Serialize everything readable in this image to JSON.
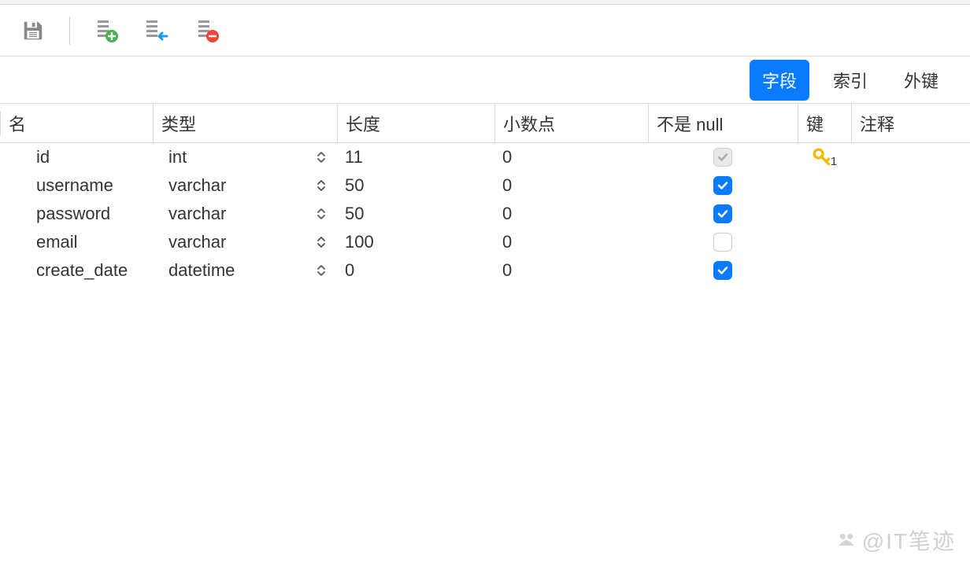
{
  "tabs": {
    "fields": "字段",
    "indexes": "索引",
    "foreign_keys": "外键"
  },
  "columns": {
    "name": "名",
    "type": "类型",
    "length": "长度",
    "decimal": "小数点",
    "not_null": "不是 null",
    "key": "键",
    "comment": "注释"
  },
  "rows": [
    {
      "name": "id",
      "type": "int",
      "length": "11",
      "decimal": "0",
      "not_null": "disabled",
      "is_key": true,
      "key_index": "1"
    },
    {
      "name": "username",
      "type": "varchar",
      "length": "50",
      "decimal": "0",
      "not_null": "checked",
      "is_key": false,
      "key_index": ""
    },
    {
      "name": "password",
      "type": "varchar",
      "length": "50",
      "decimal": "0",
      "not_null": "checked",
      "is_key": false,
      "key_index": ""
    },
    {
      "name": "email",
      "type": "varchar",
      "length": "100",
      "decimal": "0",
      "not_null": "unchecked",
      "is_key": false,
      "key_index": ""
    },
    {
      "name": "create_date",
      "type": "datetime",
      "length": "0",
      "decimal": "0",
      "not_null": "checked",
      "is_key": false,
      "key_index": ""
    }
  ],
  "watermark": "@IT笔迹"
}
